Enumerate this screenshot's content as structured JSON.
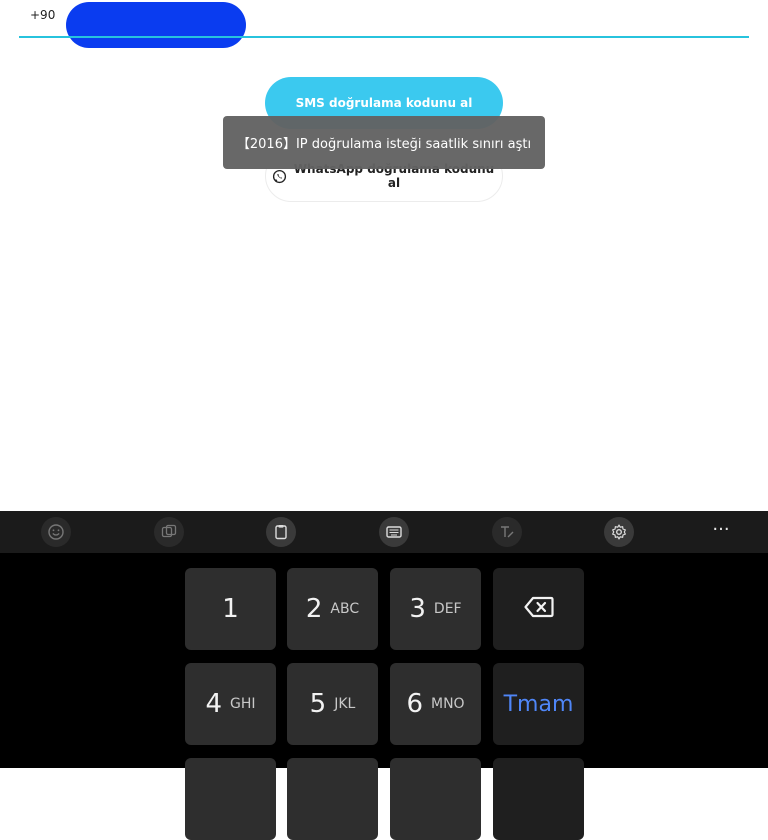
{
  "phone_field": {
    "country_code": "+90",
    "number_redacted": true
  },
  "buttons": {
    "sms_label": "SMS doğrulama kodunu al",
    "whatsapp_label": "WhatsApp doğrulama kodunu al"
  },
  "toast": {
    "message": "【2016】IP doğrulama isteği saatlik sınırı aştı"
  },
  "keyboard": {
    "toolbar_icons": [
      "emoji-icon",
      "translate-icon",
      "clipboard-icon",
      "keyboard-icon",
      "text-edit-icon",
      "gear-icon",
      "more-icon"
    ],
    "more_label": "···",
    "keys": [
      {
        "num": "1",
        "letters": ""
      },
      {
        "num": "2",
        "letters": "ABC"
      },
      {
        "num": "3",
        "letters": "DEF"
      },
      {
        "num": "4",
        "letters": "GHI"
      },
      {
        "num": "5",
        "letters": "JKL"
      },
      {
        "num": "6",
        "letters": "MNO"
      }
    ],
    "done_label": "Tmam"
  },
  "colors": {
    "accent_cyan": "#3bc9ef",
    "underline": "#27c3dd",
    "redaction_blue": "#0a3cf0",
    "done_blue": "#4f86f7",
    "keyboard_bg": "#000000",
    "key_bg": "#2e2e2e"
  }
}
